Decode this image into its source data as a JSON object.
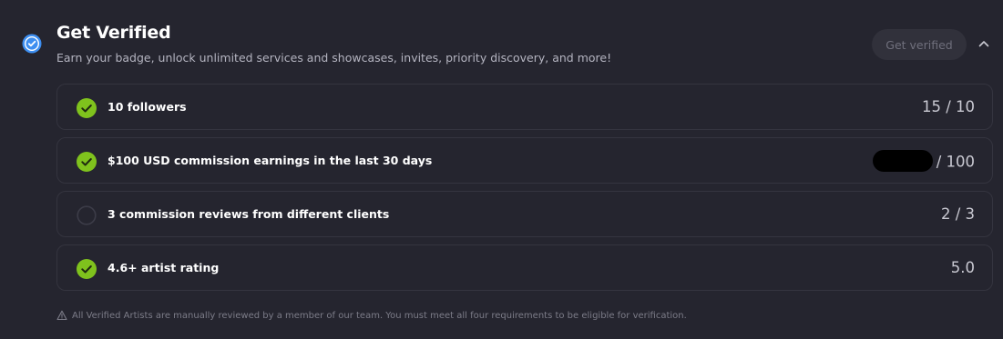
{
  "header": {
    "title": "Get Verified",
    "subtitle": "Earn your badge, unlock unlimited services and showcases, invites, priority discovery, and more!",
    "button_label": "Get verified"
  },
  "requirements": [
    {
      "label": "10 followers",
      "value": "15 / 10",
      "complete": true
    },
    {
      "label": "$100 USD commission earnings in the last 30 days",
      "value": "/ 100",
      "complete": true,
      "value_redacted": true
    },
    {
      "label": "3 commission reviews from different clients",
      "value": "2 / 3",
      "complete": false
    },
    {
      "label": "4.6+ artist rating",
      "value": "5.0",
      "complete": true
    }
  ],
  "footnote": "All Verified Artists are manually reviewed by a member of our team. You must meet all four requirements to be eligible for verification.",
  "icons": {
    "badge": "verified-badge-icon",
    "collapse": "chevron-up-icon",
    "complete": "check-circle-icon",
    "incomplete": "empty-circle-icon",
    "warning": "warning-icon"
  },
  "colors": {
    "background": "#25252f",
    "check_green": "#7fc21d",
    "badge_blue": "#3d8ef0",
    "button_bg": "#31313b",
    "button_text": "#6f6f7c"
  }
}
